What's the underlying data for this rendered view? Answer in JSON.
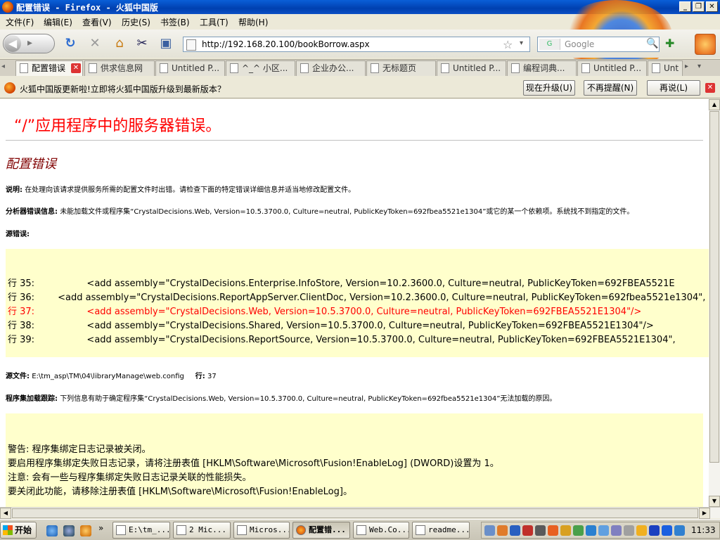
{
  "window": {
    "title": "配置错误 - Firefox - 火狐中国版",
    "min_label": "_",
    "max_label": "❐",
    "close_label": "✕"
  },
  "menu": {
    "items": [
      "文件(F)",
      "编辑(E)",
      "查看(V)",
      "历史(S)",
      "书签(B)",
      "工具(T)",
      "帮助(H)"
    ]
  },
  "nav": {
    "url": "http://192.168.20.100/bookBorrow.aspx",
    "search_placeholder": "Google",
    "search_engine_label": "G",
    "back_icon": "◀",
    "forward_icon": "▸",
    "reload_icon": "↻",
    "stop_icon": "✕",
    "home_icon": "⌂",
    "scissors_icon": "✂",
    "settings_icon": "▣",
    "star_icon": "☆",
    "dropdown_icon": "▾",
    "search_icon": "🔍",
    "plus_icon": "✚"
  },
  "tabs": {
    "scroll_left": "◂",
    "scroll_right": "▸",
    "list": "▾",
    "items": [
      {
        "label": "配置错误",
        "active": true
      },
      {
        "label": "供求信息网",
        "active": false
      },
      {
        "label": "Untitled P...",
        "active": false
      },
      {
        "label": "^_^ 小区...",
        "active": false
      },
      {
        "label": "企业办公...",
        "active": false
      },
      {
        "label": "无标题页",
        "active": false
      },
      {
        "label": "Untitled P...",
        "active": false
      },
      {
        "label": "编程词典...",
        "active": false
      },
      {
        "label": "Untitled P...",
        "active": false
      },
      {
        "label": "Unt",
        "active": false
      }
    ]
  },
  "notification": {
    "message": "火狐中国版更新啦!立即将火狐中国版升级到最新版本？",
    "upgrade_label": "现在升级(U)",
    "no_remind_label": "不再提醒(N)",
    "later_label": "再说(L)",
    "close_label": "✕"
  },
  "page": {
    "title": "“/”应用程序中的服务器错误。",
    "subtitle": "配置错误",
    "desc_label": "说明:",
    "desc_text": "在处理向该请求提供服务所需的配置文件时出错。请检查下面的特定错误详细信息并适当地修改配置文件。",
    "parser_label": "分析器错误信息:",
    "parser_text": "未能加载文件或程序集“CrystalDecisions.Web, Version=10.5.3700.0, Culture=neutral, PublicKeyToken=692fbea5521e1304”或它的某一个依赖项。系统找不到指定的文件。",
    "source_error_label": "源错误:",
    "source_lines": [
      {
        "text": "行 35:                  <add assembly=\"CrystalDecisions.Enterprise.InfoStore, Version=10.2.3600.0, Culture=neutral, PublicKeyToken=692FBEA5521E",
        "highlight": false
      },
      {
        "text": "行 36:        <add assembly=\"CrystalDecisions.ReportAppServer.ClientDoc, Version=10.2.3600.0, Culture=neutral, PublicKeyToken=692fbea5521e1304\",",
        "highlight": false
      },
      {
        "text": "行 37:                  <add assembly=\"CrystalDecisions.Web, Version=10.5.3700.0, Culture=neutral, PublicKeyToken=692FBEA5521E1304\"/>",
        "highlight": true
      },
      {
        "text": "行 38:                  <add assembly=\"CrystalDecisions.Shared, Version=10.5.3700.0, Culture=neutral, PublicKeyToken=692FBEA5521E1304\"/>",
        "highlight": false
      },
      {
        "text": "行 39:                  <add assembly=\"CrystalDecisions.ReportSource, Version=10.5.3700.0, Culture=neutral, PublicKeyToken=692FBEA5521E1304\",",
        "highlight": false
      }
    ],
    "source_file_label": "源文件:",
    "source_file_value": "E:\\tm_asp\\TM\\04\\libraryManage\\web.config",
    "line_label": "行:",
    "line_value": "37",
    "trace_label": "程序集加载跟踪:",
    "trace_text": "下列信息有助于确定程序集“CrystalDecisions.Web, Version=10.5.3700.0, Culture=neutral, PublicKeyToken=692fbea5521e1304”无法加载的原因。",
    "trace_lines": [
      "警告: 程序集绑定日志记录被关闭。",
      "要启用程序集绑定失败日志记录，请将注册表值 [HKLM\\Software\\Microsoft\\Fusion!EnableLog] (DWORD)设置为 1。",
      "注意: 会有一些与程序集绑定失败日志记录关联的性能损失。",
      "要关闭此功能，请移除注册表值 [HKLM\\Software\\Microsoft\\Fusion!EnableLog]。"
    ]
  },
  "scrollbars": {
    "up": "▲",
    "down": "▼",
    "left": "◀",
    "right": "▶"
  },
  "taskbar": {
    "start_label": "开始",
    "more_label": "»",
    "buttons": [
      {
        "label": "E:\\tm_...",
        "active": false
      },
      {
        "label": "2 Mic...",
        "active": false
      },
      {
        "label": "Micros...",
        "active": false
      },
      {
        "label": "配置错...",
        "active": true
      },
      {
        "label": "Web.Co...",
        "active": false
      },
      {
        "label": "readme...",
        "active": false
      }
    ],
    "clock": "11:33"
  },
  "colors": {
    "error_title": "#ff0000",
    "subtitle": "#800000",
    "code_bg": "#ffffcc"
  }
}
